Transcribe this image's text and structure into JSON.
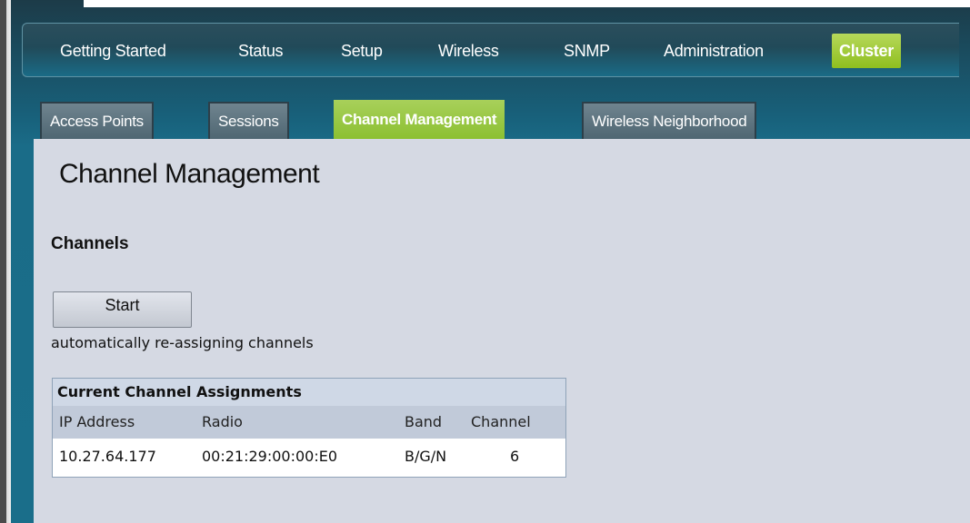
{
  "nav": {
    "items": [
      {
        "label": "Getting Started"
      },
      {
        "label": "Status"
      },
      {
        "label": "Setup"
      },
      {
        "label": "Wireless"
      },
      {
        "label": "SNMP"
      },
      {
        "label": "Administration"
      },
      {
        "label": "Cluster"
      }
    ],
    "active": "Cluster"
  },
  "sub_tabs": {
    "items": [
      {
        "label": "Access Points"
      },
      {
        "label": "Sessions"
      },
      {
        "label": "Channel Management"
      },
      {
        "label": "Wireless Neighborhood"
      }
    ],
    "active": "Channel Management"
  },
  "page": {
    "title": "Channel Management",
    "section_title": "Channels",
    "start_button_label": "Start",
    "note": "automatically re-assigning channels"
  },
  "table": {
    "caption": "Current Channel Assignments",
    "columns": [
      "IP Address",
      "Radio",
      "Band",
      "Channel"
    ],
    "rows": [
      [
        "10.27.64.177",
        "00:21:29:00:00:E0",
        "B/G/N",
        "6"
      ]
    ]
  },
  "colors": {
    "accent_green": "#9cc83a",
    "frame_teal": "#1a6e8a",
    "content_bg": "#d5d9e3"
  }
}
